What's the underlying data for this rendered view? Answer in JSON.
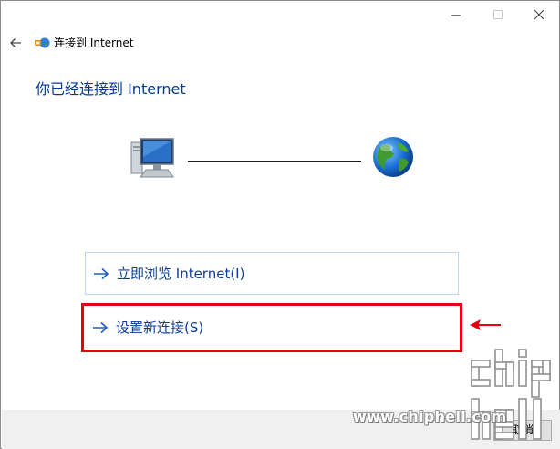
{
  "window": {
    "header_title": "连接到 Internet",
    "min_icon": "minimize-icon",
    "max_icon": "maximize-icon",
    "close_icon": "close-icon"
  },
  "main": {
    "heading": "你已经连接到 Internet",
    "options": [
      {
        "label": "立即浏览 Internet(I)",
        "icon": "arrow-right-icon"
      },
      {
        "label": "设置新连接(S)",
        "icon": "arrow-right-icon"
      }
    ]
  },
  "footer": {
    "cancel_label": "取消"
  },
  "watermark": {
    "url": "www.chiphell.com",
    "logo_text": "chiphell"
  },
  "colors": {
    "heading": "#003c96",
    "link": "#0f3d9b",
    "highlight": "#e60012",
    "footer_bg": "#f0f0f0"
  }
}
